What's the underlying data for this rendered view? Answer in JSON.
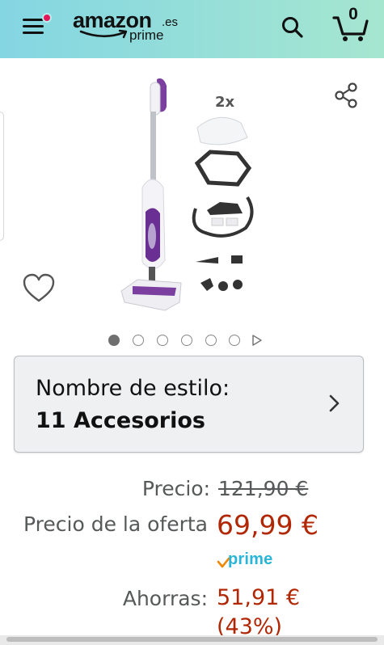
{
  "header": {
    "logo_word": "amazon",
    "logo_tld": ".es",
    "logo_prime": "prime",
    "cart_count": "0",
    "icons": {
      "menu": "hamburger-icon",
      "notification": "red-dot",
      "search": "search-icon",
      "cart": "cart-icon"
    },
    "colors": {
      "gradient_start": "#84d6e3",
      "gradient_end": "#a5e6cf",
      "notification_dot": "#e3165b"
    }
  },
  "gallery": {
    "image_count": 6,
    "active_index": 0,
    "has_video": true,
    "icons": {
      "share": "share-icon",
      "wishlist": "heart-icon",
      "video": "play-icon"
    }
  },
  "style_selector": {
    "label": "Nombre de estilo:",
    "value": "11 Accesorios"
  },
  "pricing": {
    "list_label": "Precio:",
    "list_price": "121,90 €",
    "offer_label": "Precio de la oferta",
    "offer_price": "69,99 €",
    "prime_label": "prime",
    "savings_label": "Ahorras:",
    "savings_amount": "51,91 €",
    "savings_percent": "(43%)",
    "colors": {
      "price": "#b12704",
      "prime": "#2ab5d8"
    }
  }
}
